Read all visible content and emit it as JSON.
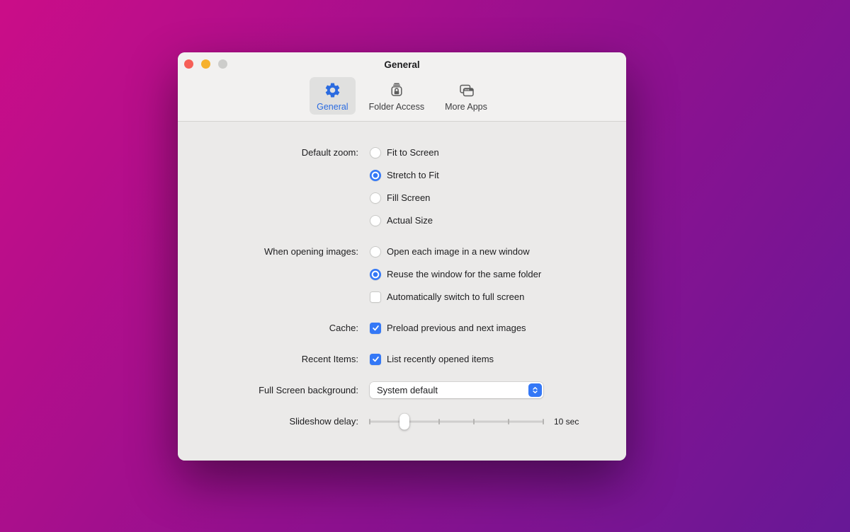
{
  "colors": {
    "bg-start": "#cb0d88",
    "bg-end": "#671896",
    "accent": "#3478f6",
    "icon-blue": "#2b6be0",
    "icon-gray": "#5c5c5c",
    "window-top": "#f2f1f0",
    "window-body": "#ebeae9",
    "text": "#1d1d1f",
    "tl-red": "#f65f57",
    "tl-yellow": "#f6b12d",
    "tl-gray": "#cdcdcb"
  },
  "window": {
    "title": "General",
    "toolbar": {
      "tabs": [
        {
          "label": "General",
          "icon": "gear-icon",
          "selected": true
        },
        {
          "label": "Folder Access",
          "icon": "folder-lock-icon",
          "selected": false
        },
        {
          "label": "More Apps",
          "icon": "overlapping-windows-icon",
          "selected": false
        }
      ]
    },
    "settings": {
      "default_zoom": {
        "label": "Default zoom:",
        "options": [
          {
            "label": "Fit to Screen",
            "selected": false
          },
          {
            "label": "Stretch to Fit",
            "selected": true
          },
          {
            "label": "Fill Screen",
            "selected": false
          },
          {
            "label": "Actual Size",
            "selected": false
          }
        ]
      },
      "opening_images": {
        "label": "When opening images:",
        "options": [
          {
            "type": "radio",
            "label": "Open each image in a new window",
            "selected": false
          },
          {
            "type": "radio",
            "label": "Reuse the window for the same folder",
            "selected": true
          },
          {
            "type": "checkbox",
            "label": "Automatically switch to full screen",
            "checked": false
          }
        ]
      },
      "cache": {
        "label": "Cache:",
        "option": {
          "label": "Preload previous and next images",
          "checked": true
        }
      },
      "recent_items": {
        "label": "Recent Items:",
        "option": {
          "label": "List recently opened items",
          "checked": true
        }
      },
      "full_screen_background": {
        "label": "Full Screen background:",
        "selected_value": "System default"
      },
      "slideshow_delay": {
        "label": "Slideshow delay:",
        "value_label": "10 sec",
        "thumb_percent": 20,
        "tick_count": 6
      }
    }
  }
}
